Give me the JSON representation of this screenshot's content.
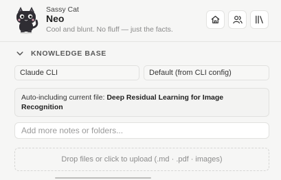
{
  "header": {
    "app_name": "Sassy Cat",
    "agent_name": "Neo",
    "tagline": "Cool and blunt. No fluff — just the facts.",
    "buttons": {
      "home_icon": "home-icon",
      "people_icon": "people-icon",
      "library_icon": "library-icon"
    }
  },
  "knowledge_base": {
    "title": "KNOWLEDGE BASE",
    "expanded": true,
    "provider_select": "Claude CLI",
    "model_select": "Default (from CLI config)",
    "auto_include_prefix": "Auto-including current file: ",
    "auto_include_file": "Deep Residual Learning for Image Recognition",
    "notes_placeholder": "Add more notes or folders...",
    "notes_value": "",
    "dropzone_text": "Drop files or click to upload (.md · .pdf · images)"
  },
  "colors": {
    "background": "#f6f6f5",
    "border": "#e1e1df",
    "text": "#2b2b2b",
    "muted": "#8a8a8a"
  }
}
